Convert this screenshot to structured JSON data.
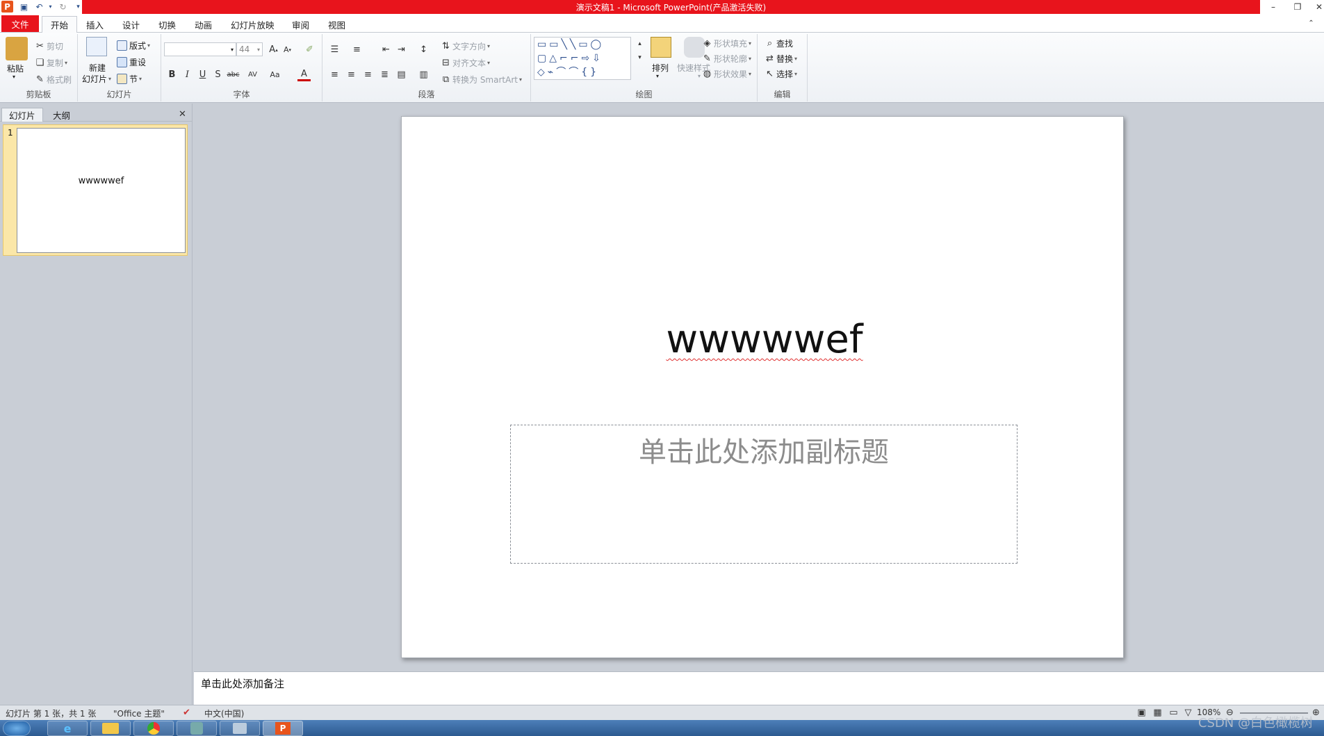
{
  "window": {
    "title": "演示文稿1 - Microsoft PowerPoint(产品激活失败)"
  },
  "tabs": [
    {
      "label": "文件"
    },
    {
      "label": "开始"
    },
    {
      "label": "插入"
    },
    {
      "label": "设计"
    },
    {
      "label": "切换"
    },
    {
      "label": "动画"
    },
    {
      "label": "幻灯片放映"
    },
    {
      "label": "审阅"
    },
    {
      "label": "视图"
    }
  ],
  "ribbon": {
    "clipboard": {
      "paste": "粘贴",
      "cut": "剪切",
      "copy": "复制",
      "format_painter": "格式刷",
      "label": "剪贴板"
    },
    "slides": {
      "new_slide_1": "新建",
      "new_slide_2": "幻灯片",
      "layout": "版式",
      "reset": "重设",
      "section": "节",
      "label": "幻灯片"
    },
    "font": {
      "size": "44",
      "label": "字体"
    },
    "paragraph": {
      "text_direction": "文字方向",
      "align_text": "对齐文本",
      "smartart": "转换为 SmartArt",
      "label": "段落"
    },
    "drawing": {
      "arrange": "排列",
      "quick_styles": "快速样式",
      "shape_fill": "形状填充",
      "shape_outline": "形状轮廓",
      "shape_effects": "形状效果",
      "label": "绘图"
    },
    "editing": {
      "find": "查找",
      "replace": "替换",
      "select": "选择",
      "label": "编辑"
    }
  },
  "left_pane": {
    "tabs": [
      "幻灯片",
      "大纲"
    ],
    "slide_number": "1",
    "thumb_title": "wwwwwef"
  },
  "slide": {
    "title": "wwwwwef",
    "subtitle_placeholder": "单击此处添加副标题"
  },
  "notes": {
    "placeholder": "单击此处添加备注"
  },
  "status": {
    "slide_info": "幻灯片 第 1 张，共 1 张",
    "theme": "\"Office 主题\"",
    "language": "中文(中国)",
    "zoom": "108%"
  },
  "watermark": "CSDN @白色橄榄树",
  "colors": {
    "accent": "#e8141c",
    "selection": "#fbe7a8"
  }
}
